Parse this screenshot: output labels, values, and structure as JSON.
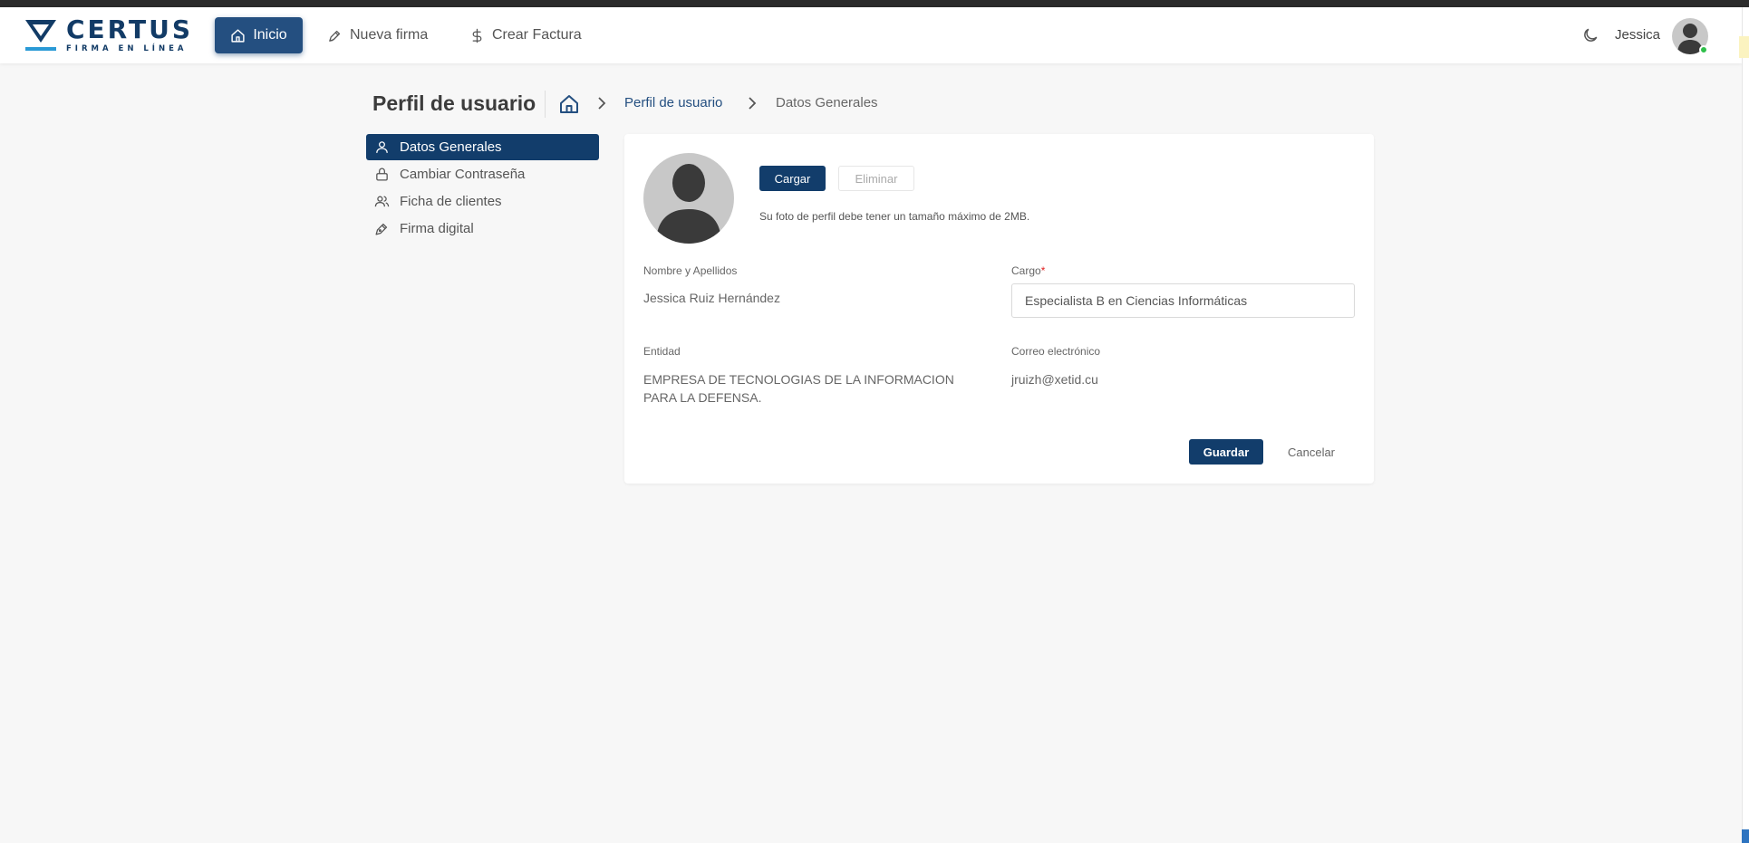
{
  "brand": {
    "name": "CERTUS",
    "subtitle": "FIRMA EN LÍNEA",
    "color": "#123b66",
    "accent": "#2a9ad6"
  },
  "nav": {
    "items": [
      {
        "label": "Inicio",
        "icon": "home-icon",
        "active": true
      },
      {
        "label": "Nueva firma",
        "icon": "pen-icon"
      },
      {
        "label": "Crear Factura",
        "icon": "dollar-icon"
      }
    ],
    "user": {
      "name": "Jessica",
      "status": "online"
    },
    "theme_icon": "moon-icon"
  },
  "page": {
    "title": "Perfil de usuario",
    "breadcrumb": {
      "home_icon": "home-icon",
      "link": "Perfil de usuario",
      "current": "Datos Generales"
    }
  },
  "sidebar": {
    "items": [
      {
        "label": "Datos Generales",
        "icon": "user-icon",
        "active": true
      },
      {
        "label": "Cambiar Contraseña",
        "icon": "lock-icon"
      },
      {
        "label": "Ficha de clientes",
        "icon": "users-icon"
      },
      {
        "label": "Firma digital",
        "icon": "signature-pen-icon"
      }
    ]
  },
  "profile": {
    "upload_label": "Cargar",
    "delete_label": "Eliminar",
    "photo_hint": "Su foto de perfil debe tener un tamaño máximo de 2MB.",
    "fields": {
      "nombre": {
        "label": "Nombre y Apellidos",
        "value": "Jessica Ruiz Hernández"
      },
      "cargo": {
        "label": "Cargo",
        "required_mark": "*",
        "value": "Especialista B en Ciencias Informáticas"
      },
      "entidad": {
        "label": "Entidad",
        "value": "EMPRESA DE TECNOLOGIAS DE LA INFORMACION PARA LA DEFENSA."
      },
      "correo": {
        "label": "Correo electrónico",
        "value": "jruizh@xetid.cu"
      }
    },
    "save_label": "Guardar",
    "cancel_label": "Cancelar"
  },
  "colors": {
    "primary": "#123d6b",
    "nav_active": "#244f80",
    "background": "#f7f7f7",
    "required": "#e02020",
    "online": "#2fbf4a"
  }
}
